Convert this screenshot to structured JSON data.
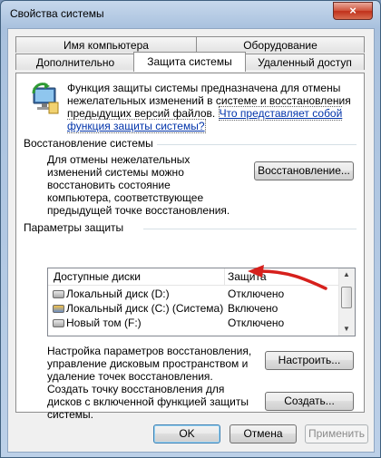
{
  "window": {
    "title": "Свойства системы",
    "close_label": "×"
  },
  "tabs": {
    "row1": [
      "Имя компьютера",
      "Оборудование"
    ],
    "row2": [
      "Дополнительно",
      "Защита системы",
      "Удаленный доступ"
    ],
    "active": "Защита системы"
  },
  "intro": {
    "text": "Функция защиты системы предназначена для отмены нежелательных изменений в системе и восстановления предыдущих версий файлов.",
    "link": "Что представляет собой функция защиты системы?"
  },
  "restore": {
    "title": "Восстановление системы",
    "description": "Для отмены нежелательных изменений системы можно восстановить состояние компьютера, соответствующее предыдущей точке восстановления.",
    "button": "Восстановление..."
  },
  "protection": {
    "title": "Параметры защиты",
    "columns": [
      "Доступные диски",
      "Защита"
    ],
    "rows": [
      {
        "name": "Локальный диск (D:)",
        "state": "Отключено",
        "icon": "drive-icon"
      },
      {
        "name": "Локальный диск (C:) (Система)",
        "state": "Включено",
        "icon": "system-drive-icon"
      },
      {
        "name": "Новый том (F:)",
        "state": "Отключено",
        "icon": "drive-icon"
      }
    ],
    "configure_text": "Настройка параметров восстановления, управление дисковым пространством и удаление точек восстановления.",
    "configure_button": "Настроить...",
    "create_text": "Создать точку восстановления для дисков с включенной функцией защиты системы.",
    "create_button": "Создать..."
  },
  "footer": {
    "ok": "OK",
    "cancel": "Отмена",
    "apply": "Применить"
  },
  "colors": {
    "annotation_arrow": "#d6201c",
    "link": "#0033aa",
    "close_button": "#c0301b"
  }
}
